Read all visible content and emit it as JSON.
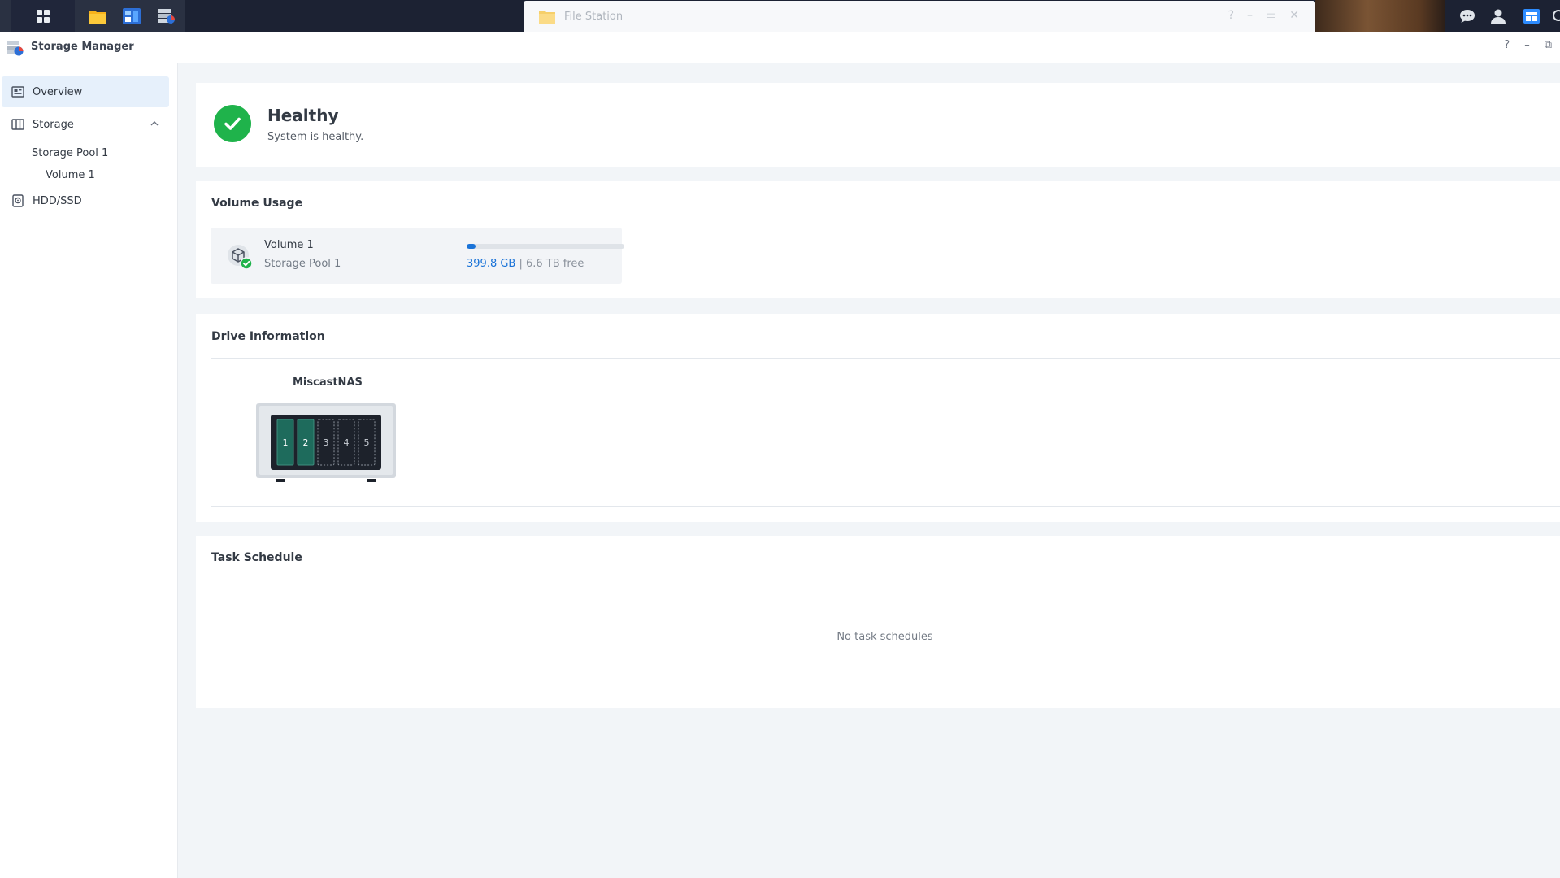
{
  "taskbar": {
    "file_station_title": "File Station",
    "file_station_controls": [
      "?",
      "–",
      "▭",
      "✕"
    ]
  },
  "window": {
    "title": "Storage Manager",
    "controls": [
      "?",
      "–",
      "⧉"
    ]
  },
  "sidebar": {
    "overview": "Overview",
    "storage": "Storage",
    "storage_pool": "Storage Pool 1",
    "volume": "Volume 1",
    "hdd": "HDD/SSD"
  },
  "health": {
    "status": "Healthy",
    "message": "System is healthy."
  },
  "volume_usage": {
    "title": "Volume Usage",
    "volume_name": "Volume 1",
    "pool_name": "Storage Pool 1",
    "used": "399.8 GB",
    "separator": " | ",
    "free": "6.6 TB free",
    "used_fraction": 0.057
  },
  "drive_info": {
    "title": "Drive Information",
    "nas_name": "MiscastNAS",
    "bays": [
      {
        "label": "1",
        "populated": true
      },
      {
        "label": "2",
        "populated": true
      },
      {
        "label": "3",
        "populated": false
      },
      {
        "label": "4",
        "populated": false
      },
      {
        "label": "5",
        "populated": false
      }
    ]
  },
  "task_schedule": {
    "title": "Task Schedule",
    "empty_message": "No task schedules"
  },
  "colors": {
    "accent": "#1a73d8",
    "healthy": "#1fb34b",
    "drive_populated": "#1e6b5c"
  }
}
